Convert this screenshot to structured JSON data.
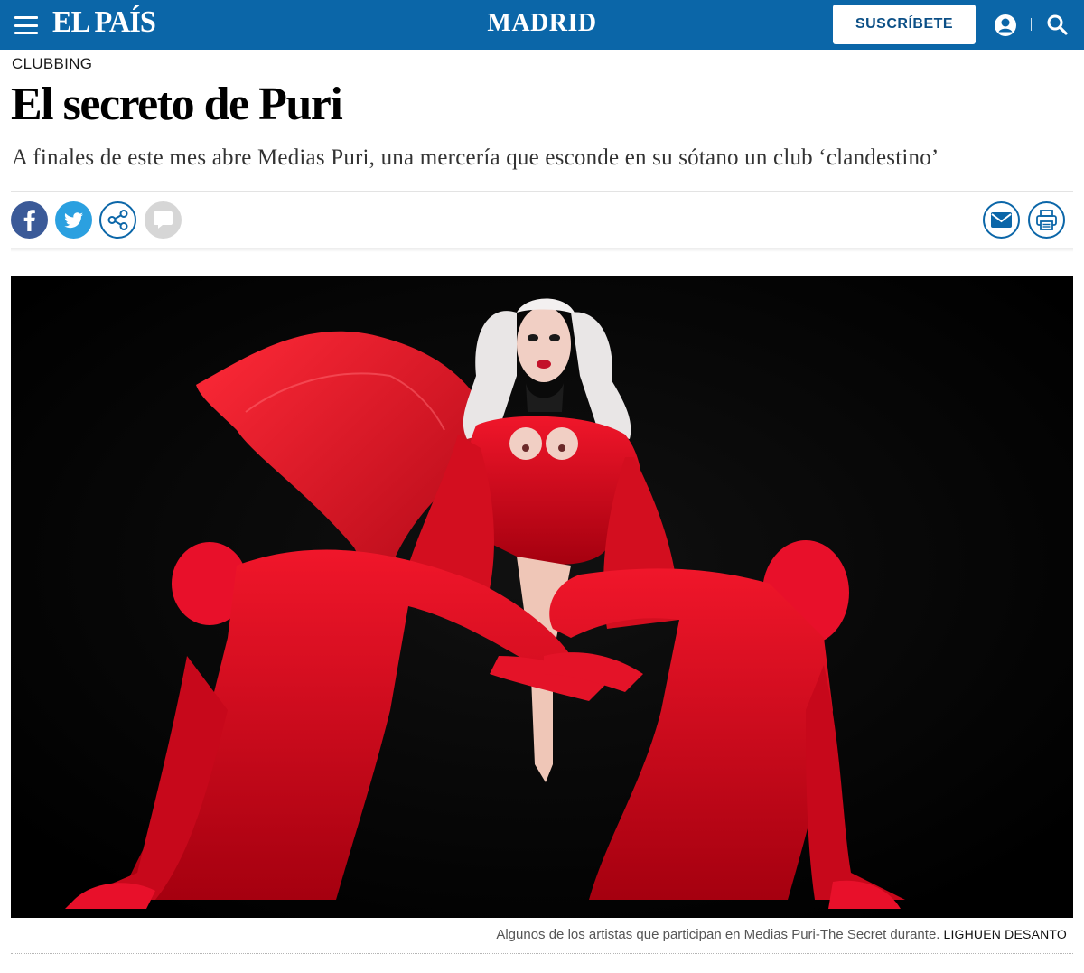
{
  "header": {
    "logo": "EL PAÍS",
    "section": "MADRID",
    "subscribe_label": "SUSCRÍBETE",
    "brand_color": "#0b66a8"
  },
  "article": {
    "kicker": "CLUBBING",
    "title": "El secreto de Puri",
    "subtitle": "A finales de este mes abre Medias Puri, una mercería que esconde en su sótano un club ‘clandestino’"
  },
  "share": {
    "left_icons": [
      "facebook-icon",
      "twitter-icon",
      "share-icon",
      "comment-icon"
    ],
    "right_icons": [
      "mail-icon",
      "print-icon"
    ],
    "colors": {
      "facebook": "#3b5a98",
      "twitter": "#2ba0e0",
      "outline": "#0b66a8",
      "comment": "#d6d6d6"
    }
  },
  "photo": {
    "caption": "Algunos de los artistas que participan en Medias Puri-The Secret durante.",
    "credit": "LIGHUEN DESANTO"
  }
}
